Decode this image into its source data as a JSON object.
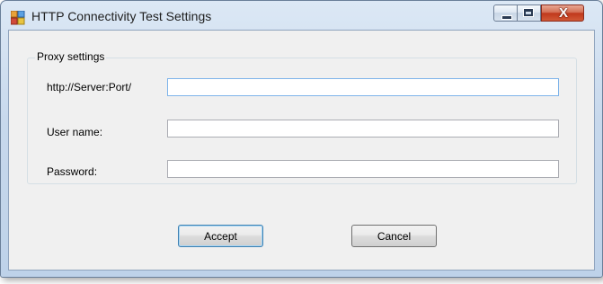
{
  "window": {
    "title": "HTTP Connectivity Test Settings",
    "icon": "app-window-icon",
    "controls": {
      "minimize": "minimize-icon",
      "maximize": "maximize-icon",
      "close_glyph": "X"
    }
  },
  "proxy": {
    "group_label": "Proxy settings",
    "fields": [
      {
        "label": "http://Server:Port/",
        "value": ""
      },
      {
        "label": "User name:",
        "value": ""
      },
      {
        "label": "Password:",
        "value": ""
      }
    ]
  },
  "actions": {
    "accept_label": "Accept",
    "cancel_label": "Cancel"
  },
  "colors": {
    "close_button": "#c7402a",
    "default_button_border": "#3c7fb1",
    "focus_border": "#7eb4ea"
  }
}
